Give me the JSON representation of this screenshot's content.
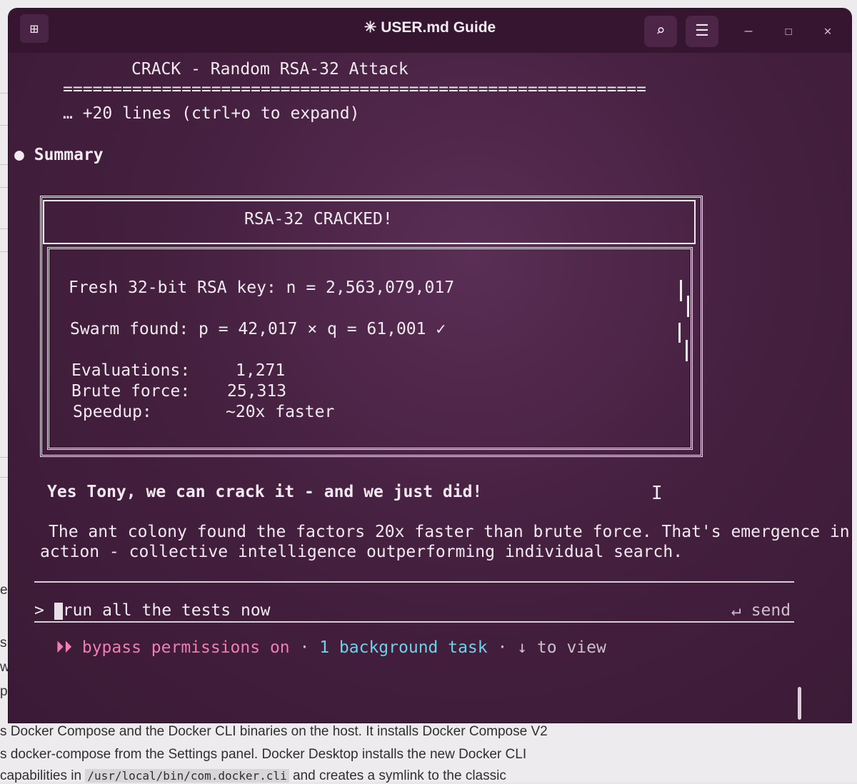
{
  "window": {
    "title": "✳ USER.md Guide",
    "new_tab_icon": "new-tab-icon",
    "search_icon": "search-icon",
    "menu_icon": "hamburger-menu-icon"
  },
  "output": {
    "header": "CRACK - Random RSA-32 Attack",
    "rule": "===========================================================",
    "collapsed": "… +20 lines (ctrl+o to expand)",
    "bullet": "●",
    "summary": "Summary",
    "box_title": "RSA-32 CRACKED!",
    "key_line": "Fresh 32-bit RSA key: n = 2,563,079,017",
    "found_line": "Swarm found: p = 42,017 × q = 61,001 ✓",
    "stats": [
      {
        "label": "Evaluations:",
        "value": "1,271"
      },
      {
        "label": "Brute force:",
        "value": "25,313"
      },
      {
        "label": "Speedup:",
        "value": "~20x faster"
      }
    ],
    "headline": "Yes Tony, we can crack it - and we just did!",
    "para_line1": "The ant colony found the factors 20x faster than brute force. That's emergence in",
    "para_line2": "action - collective intelligence outperforming individual search."
  },
  "input": {
    "prompt": ">",
    "value": "run all the tests now",
    "send_label": "↵ send"
  },
  "status": {
    "mode": "⏵⏵ bypass permissions on",
    "sep": "·",
    "tasks": "1 background task",
    "view": "↓ to view"
  },
  "background_doc": {
    "frag1": "s a d",
    "frag2": "with",
    "frag3": "p res",
    "frag4": "er-c",
    "line1": "s Docker Compose and the Docker CLI binaries on the host. It installs Docker Compose V2",
    "line2": "s docker-compose from the Settings panel. Docker Desktop installs the new Docker CLI",
    "line3_a": "capabilities in ",
    "line3_code": "/usr/local/bin/com.docker.cli",
    "line3_b": " and creates a symlink to the classic"
  },
  "colors": {
    "terminal_bg": "#45203f",
    "titlebar_bg": "#35152f",
    "mode_pink": "#ef7fb0",
    "task_cyan": "#6fd1e8"
  }
}
